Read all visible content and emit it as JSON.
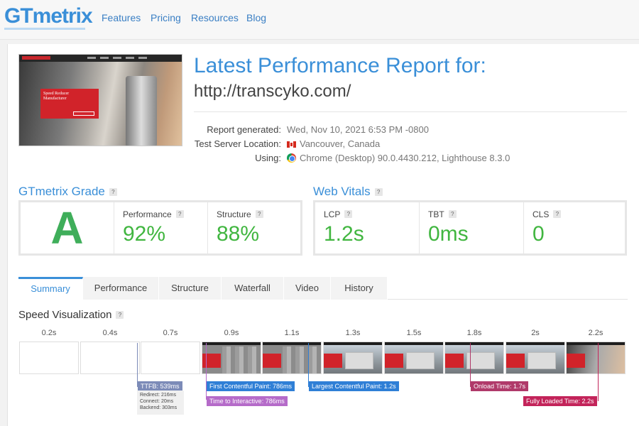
{
  "nav": {
    "logo": "GTmetrix",
    "links": [
      "Features",
      "Pricing",
      "Resources",
      "Blog"
    ]
  },
  "report": {
    "title": "Latest Performance Report for:",
    "url": "http://transcyko.com/",
    "meta": [
      {
        "label": "Report generated:",
        "value": "Wed, Nov 10, 2021 6:53 PM -0800"
      },
      {
        "label": "Test Server Location:",
        "value": "Vancouver, Canada",
        "icon": "canada-flag-icon"
      },
      {
        "label": "Using:",
        "value": "Chrome (Desktop) 90.0.4430.212, Lighthouse 8.3.0",
        "icon": "chrome-icon"
      }
    ]
  },
  "thumbnail": {
    "banner_text": "Speed Reducer Manufacturer"
  },
  "grade": {
    "title": "GTmetrix Grade",
    "letter": "A",
    "performance_label": "Performance",
    "performance_value": "92%",
    "structure_label": "Structure",
    "structure_value": "88%"
  },
  "vitals": {
    "title": "Web Vitals",
    "items": [
      {
        "label": "LCP",
        "value": "1.2s"
      },
      {
        "label": "TBT",
        "value": "0ms"
      },
      {
        "label": "CLS",
        "value": "0"
      }
    ]
  },
  "tabs": [
    "Summary",
    "Performance",
    "Structure",
    "Waterfall",
    "Video",
    "History"
  ],
  "speed": {
    "title": "Speed Visualization",
    "times": [
      "0.2s",
      "0.4s",
      "0.7s",
      "0.9s",
      "1.1s",
      "1.3s",
      "1.5s",
      "1.8s",
      "2s",
      "2.2s"
    ],
    "markers": {
      "ttfb": "TTFB: 539ms",
      "fcp": "First Contentful Paint: 786ms",
      "tti": "Time to Interactive: 786ms",
      "lcp": "Largest Contentful Paint: 1.2s",
      "onload": "Onload Time: 1.7s",
      "fully_loaded": "Fully Loaded Time: 2.2s"
    },
    "ttfb_detail": [
      "Redirect: 216ms",
      "Connect: 20ms",
      "Backend: 303ms"
    ]
  },
  "help_glyph": "?"
}
